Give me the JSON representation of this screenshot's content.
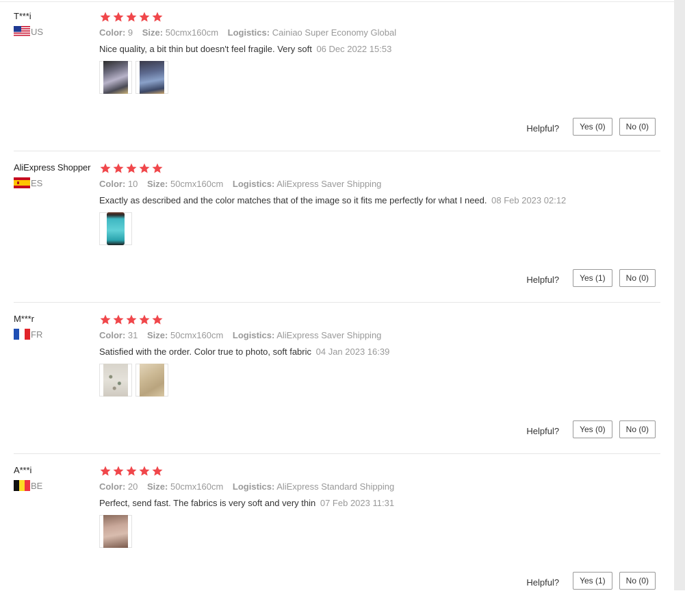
{
  "helpful_label": "Helpful?",
  "colors": {
    "star": "#f0474b",
    "accent_muted": "#999999"
  },
  "reviews": [
    {
      "username": "T***i",
      "country": "US",
      "flag": "us",
      "rating": 5,
      "color_label": "Color:",
      "color": "9",
      "size_label": "Size:",
      "size": "50cmx160cm",
      "logistics_label": "Logistics:",
      "logistics": "Cainiao Super Economy Global",
      "text": "Nice quality, a bit thin but doesn't feel fragile. Very soft",
      "date": "06 Dec 2022 15:53",
      "photos": [
        "photo-folded-fabric-dark",
        "photo-folded-fabric-blue"
      ],
      "yes": "Yes (0)",
      "no": "No (0)"
    },
    {
      "username": "AliExpress Shopper",
      "country": "ES",
      "flag": "es",
      "rating": 5,
      "color_label": "Color:",
      "color": "10",
      "size_label": "Size:",
      "size": "50cmx160cm",
      "logistics_label": "Logistics:",
      "logistics": "AliExpress Saver Shipping",
      "text": "Exactly as described and the color matches that of the image so it fits me perfectly for what I need.",
      "date": "08 Feb 2023 02:12",
      "photos": [
        "photo-turquoise-fabric"
      ],
      "yes": "Yes (1)",
      "no": "No (0)"
    },
    {
      "username": "M***r",
      "country": "FR",
      "flag": "fr",
      "rating": 5,
      "color_label": "Color:",
      "color": "31",
      "size_label": "Size:",
      "size": "50cmx160cm",
      "logistics_label": "Logistics:",
      "logistics": "AliExpress Saver Shipping",
      "text": "Satisfied with the order. Color true to photo, soft fabric",
      "date": "04 Jan 2023 16:39",
      "photos": [
        "photo-floral-fabric",
        "photo-beige-fabric"
      ],
      "yes": "Yes (0)",
      "no": "No (0)"
    },
    {
      "username": "A***i",
      "country": "BE",
      "flag": "be",
      "rating": 5,
      "color_label": "Color:",
      "color": "20",
      "size_label": "Size:",
      "size": "50cmx160cm",
      "logistics_label": "Logistics:",
      "logistics": "AliExpress Standard Shipping",
      "text": "Perfect, send fast. The fabrics is very soft and very thin",
      "date": "07 Feb 2023 11:31",
      "photos": [
        "photo-pink-fabric"
      ],
      "yes": "Yes (1)",
      "no": "No (0)"
    }
  ]
}
